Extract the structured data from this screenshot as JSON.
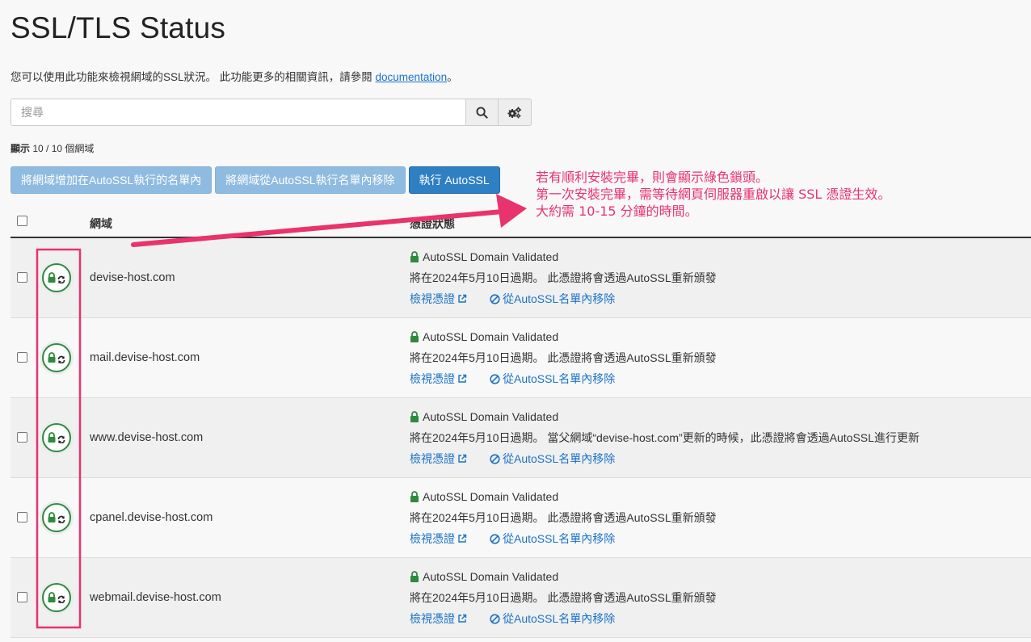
{
  "header": {
    "title": "SSL/TLS Status",
    "intro_text": "您可以使用此功能來檢視網域的SSL狀況。 此功能更多的相關資訊，請參閱 ",
    "intro_link": "documentation",
    "intro_end": "。"
  },
  "search": {
    "placeholder": "搜尋",
    "value": ""
  },
  "count": {
    "label": "顯示",
    "value": " 10 / 10 個網域"
  },
  "actions": {
    "add_label": "將網域增加在AutoSSL執行的名單內",
    "remove_label": "將網域從AutoSSL執行名單內移除",
    "run_label": "執行 AutoSSL"
  },
  "table": {
    "col_domain": "網域",
    "col_status": "憑證狀態",
    "rows": [
      {
        "domain": "devise-host.com",
        "status": "AutoSSL Domain Validated",
        "expiry": "將在2024年5月10日過期。 此憑證將會透過AutoSSL重新頒發",
        "view": "檢視憑證",
        "remove": "從AutoSSL名單內移除"
      },
      {
        "domain": "mail.devise-host.com",
        "status": "AutoSSL Domain Validated",
        "expiry": "將在2024年5月10日過期。 此憑證將會透過AutoSSL重新頒發",
        "view": "檢視憑證",
        "remove": "從AutoSSL名單內移除"
      },
      {
        "domain": "www.devise-host.com",
        "status": "AutoSSL Domain Validated",
        "expiry": "將在2024年5月10日過期。 當父網域“devise-host.com”更新的時候，此憑證將會透過AutoSSL進行更新",
        "view": "檢視憑證",
        "remove": "從AutoSSL名單內移除"
      },
      {
        "domain": "cpanel.devise-host.com",
        "status": "AutoSSL Domain Validated",
        "expiry": "將在2024年5月10日過期。 此憑證將會透過AutoSSL重新頒發",
        "view": "檢視憑證",
        "remove": "從AutoSSL名單內移除"
      },
      {
        "domain": "webmail.devise-host.com",
        "status": "AutoSSL Domain Validated",
        "expiry": "將在2024年5月10日過期。 此憑證將會透過AutoSSL重新頒發",
        "view": "檢視憑證",
        "remove": "從AutoSSL名單內移除"
      }
    ]
  },
  "annotation": {
    "line1": "若有順利安裝完畢，則會顯示綠色鎖頭。",
    "line2": "第一次安裝完畢，需等待網頁伺服器重啟以讓 SSL 憑證生效。",
    "line3": "大約需 10-15 分鐘的時間。"
  },
  "colors": {
    "annotation": "#e8336d",
    "lock_green": "#2e8a3c",
    "link_blue": "#1a73c8",
    "primary_button": "#2f7fc3"
  },
  "icons": {
    "search": "search-icon",
    "settings": "gears-icon",
    "lock": "lock-icon",
    "external": "external-link-icon",
    "ban": "ban-icon"
  }
}
